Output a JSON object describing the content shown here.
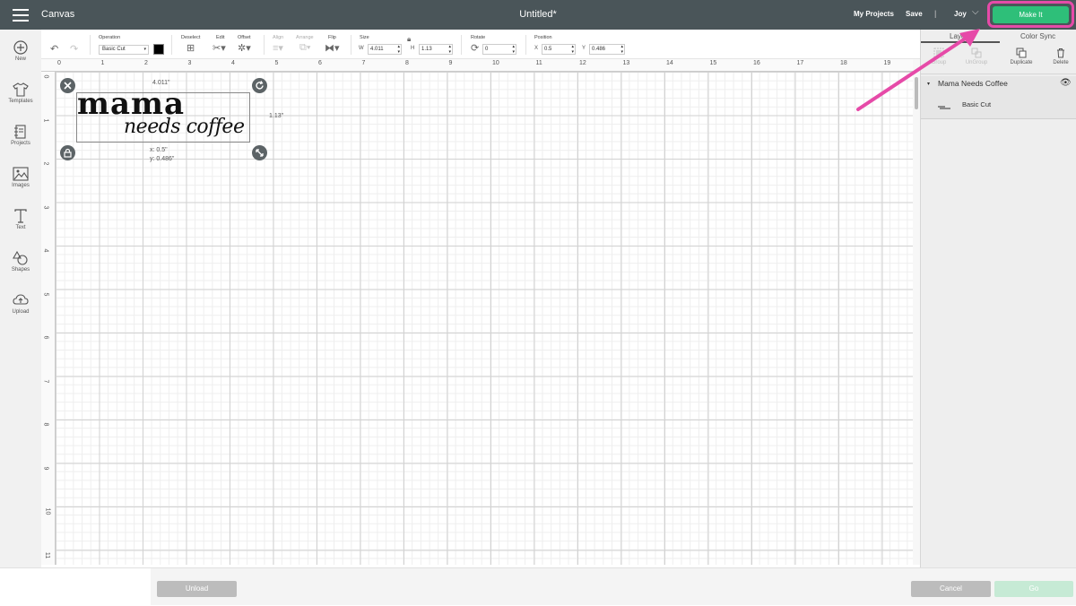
{
  "header": {
    "app_title": "Canvas",
    "doc_title": "Untitled*",
    "my_projects": "My Projects",
    "save": "Save",
    "separator": "|",
    "user": "Joy",
    "make_it": "Make It"
  },
  "sidebar": {
    "items": [
      {
        "label": "New",
        "icon": "plus-circle-icon"
      },
      {
        "label": "Templates",
        "icon": "tshirt-icon"
      },
      {
        "label": "Projects",
        "icon": "notebook-icon"
      },
      {
        "label": "Images",
        "icon": "image-icon"
      },
      {
        "label": "Text",
        "icon": "text-T-icon"
      },
      {
        "label": "Shapes",
        "icon": "shapes-icon"
      },
      {
        "label": "Upload",
        "icon": "cloud-upload-icon"
      }
    ]
  },
  "toolbar": {
    "operation_label": "Operation",
    "operation_value": "Basic Cut",
    "deselect_label": "Deselect",
    "edit_label": "Edit",
    "offset_label": "Offset",
    "align_label": "Align",
    "arrange_label": "Arrange",
    "flip_label": "Flip",
    "size_label": "Size",
    "w_label": "W",
    "w_value": "4.011",
    "h_label": "H",
    "h_value": "1.13",
    "rotate_label": "Rotate",
    "rotate_value": "0",
    "position_label": "Position",
    "x_label": "X",
    "x_value": "0.5",
    "y_label": "Y",
    "y_value": "0.486"
  },
  "canvas": {
    "ruler_top": [
      "0",
      "1",
      "2",
      "3",
      "4",
      "5",
      "6",
      "7",
      "8",
      "9",
      "10",
      "11",
      "12",
      "13",
      "14",
      "15",
      "16",
      "17",
      "18",
      "19"
    ],
    "ruler_left": [
      "0",
      "1",
      "2",
      "3",
      "4",
      "5",
      "6",
      "7",
      "8",
      "9",
      "10",
      "11"
    ],
    "design_line1": "mama",
    "design_line2": "needs coffee",
    "width_readout": "4.011\"",
    "height_readout": "1.13\"",
    "pos_x_readout": "x: 0.5\"",
    "pos_y_readout": "y: 0.486\""
  },
  "layers_panel": {
    "tab_layers": "Layers",
    "tab_color_sync": "Color Sync",
    "tools": [
      {
        "label": "Group",
        "enabled": false
      },
      {
        "label": "UnGroup",
        "enabled": false
      },
      {
        "label": "Duplicate",
        "enabled": true
      },
      {
        "label": "Delete",
        "enabled": true
      }
    ],
    "layer_name": "Mama Needs Coffee",
    "sublayer_name": "Basic Cut"
  },
  "bottom": {
    "unload": "Unload",
    "cancel": "Cancel",
    "go": "Go"
  },
  "colors": {
    "topbar": "#4a5559",
    "make_it": "#2ebf79",
    "highlight": "#e64aa8"
  }
}
